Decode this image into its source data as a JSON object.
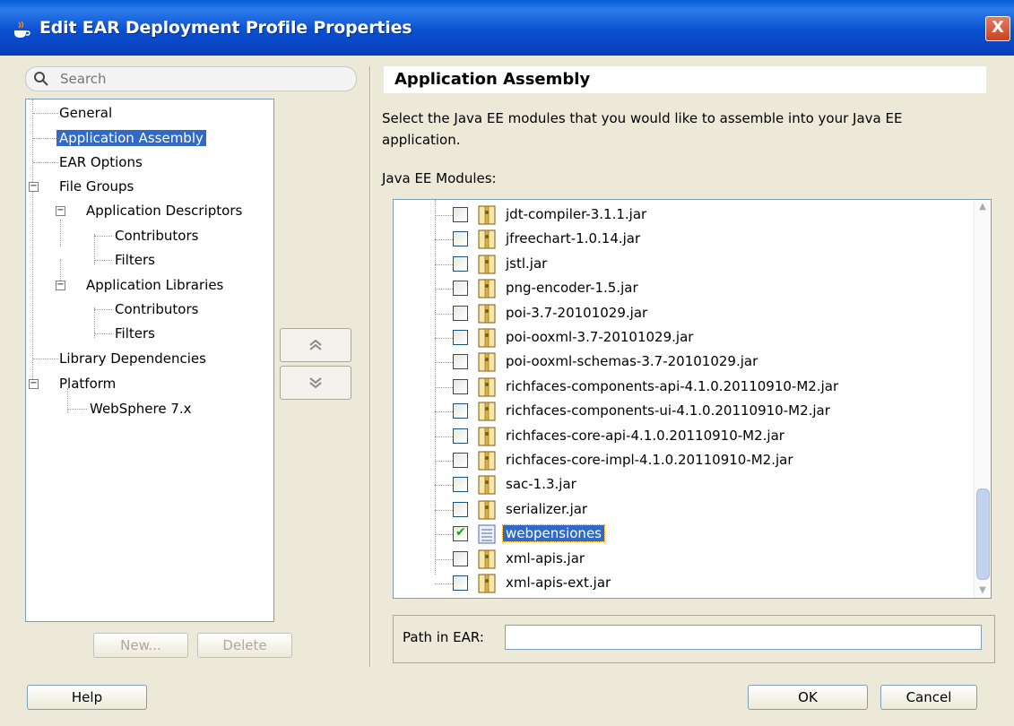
{
  "window": {
    "title": "Edit EAR Deployment Profile Properties",
    "close_label": "X"
  },
  "search": {
    "placeholder": "Search"
  },
  "nav": {
    "items": [
      {
        "label": "General"
      },
      {
        "label": "Application Assembly"
      },
      {
        "label": "EAR Options"
      },
      {
        "label": "File Groups"
      },
      {
        "label": "Application Descriptors"
      },
      {
        "label": "Contributors"
      },
      {
        "label": "Filters"
      },
      {
        "label": "Application Libraries"
      },
      {
        "label": "Contributors"
      },
      {
        "label": "Filters"
      },
      {
        "label": "Library Dependencies"
      },
      {
        "label": "Platform"
      },
      {
        "label": "WebSphere 7.x"
      }
    ],
    "new_button": "New...",
    "delete_button": "Delete"
  },
  "section": {
    "title": "Application Assembly",
    "description": "Select the Java EE modules that you would like to assemble into your Java EE application.",
    "modules_label": "Java EE Modules:",
    "modules": [
      {
        "name": "jdt-compiler-3.1.1.jar",
        "checked": false
      },
      {
        "name": "jfreechart-1.0.14.jar",
        "checked": false
      },
      {
        "name": "jstl.jar",
        "checked": false
      },
      {
        "name": "png-encoder-1.5.jar",
        "checked": false
      },
      {
        "name": "poi-3.7-20101029.jar",
        "checked": false
      },
      {
        "name": "poi-ooxml-3.7-20101029.jar",
        "checked": false
      },
      {
        "name": "poi-ooxml-schemas-3.7-20101029.jar",
        "checked": false
      },
      {
        "name": "richfaces-components-api-4.1.0.20110910-M2.jar",
        "checked": false
      },
      {
        "name": "richfaces-components-ui-4.1.0.20110910-M2.jar",
        "checked": false
      },
      {
        "name": "richfaces-core-api-4.1.0.20110910-M2.jar",
        "checked": false
      },
      {
        "name": "richfaces-core-impl-4.1.0.20110910-M2.jar",
        "checked": false
      },
      {
        "name": "sac-1.3.jar",
        "checked": false
      },
      {
        "name": "serializer.jar",
        "checked": false
      },
      {
        "name": "webpensiones",
        "checked": true
      },
      {
        "name": "xml-apis.jar",
        "checked": false
      },
      {
        "name": "xml-apis-ext.jar",
        "checked": false
      }
    ],
    "path_label": "Path in EAR:",
    "path_value": ""
  },
  "footer": {
    "help": "Help",
    "ok": "OK",
    "cancel": "Cancel"
  }
}
